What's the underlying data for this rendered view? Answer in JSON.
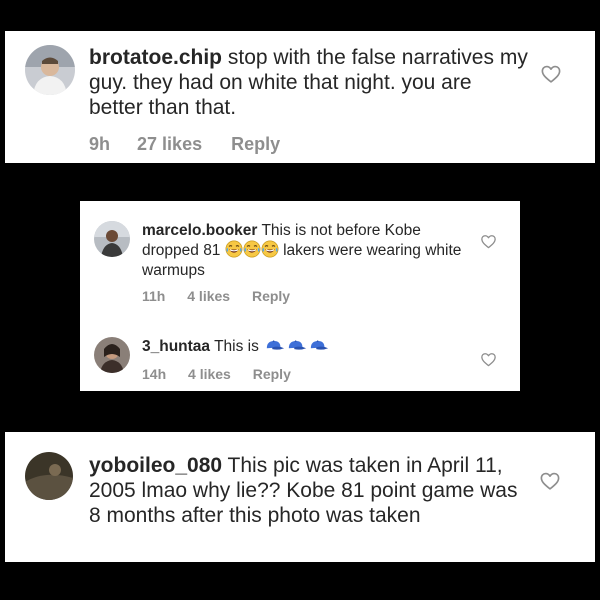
{
  "comments": [
    {
      "username": "brotatoe.chip",
      "text": "stop with the false narratives my guy. they had on white that night. you are better than that.",
      "time": "9h",
      "likes": "27 likes",
      "reply": "Reply",
      "icons": [
        "avatar",
        "heart-outline-icon"
      ]
    },
    {
      "username": "marcelo.booker",
      "text_before": "This is not before Kobe dropped 81",
      "text_after": "lakers were wearing white warmups",
      "emoji": [
        "face-with-tears-of-joy",
        "face-with-tears-of-joy",
        "face-with-tears-of-joy"
      ],
      "time": "11h",
      "likes": "4 likes",
      "reply": "Reply",
      "icons": [
        "avatar",
        "heart-outline-icon"
      ]
    },
    {
      "username": "3_huntaa",
      "text": "This is",
      "emoji": [
        "blue-cap",
        "blue-cap",
        "blue-cap"
      ],
      "time": "14h",
      "likes": "4 likes",
      "reply": "Reply",
      "icons": [
        "avatar",
        "heart-outline-icon"
      ]
    },
    {
      "username": "yoboileo_080",
      "text": "This pic was taken in April 11, 2005 lmao why lie?? Kobe 81 point game was 8 months after this photo was taken",
      "icons": [
        "avatar",
        "heart-outline-icon"
      ]
    }
  ],
  "colors": {
    "background": "#000000",
    "card": "#ffffff",
    "text": "#262626",
    "meta": "#8e8e8e",
    "cap": "#3d6fd8"
  }
}
